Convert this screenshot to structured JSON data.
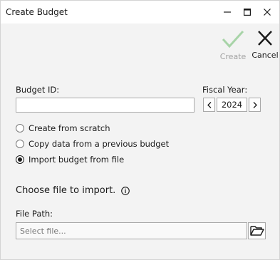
{
  "window": {
    "title": "Create Budget"
  },
  "toolbar": {
    "create_label": "Create",
    "cancel_label": "Cancel",
    "create_icon": "checkmark-icon",
    "cancel_icon": "close-x-icon"
  },
  "form": {
    "budget_id_label": "Budget ID:",
    "budget_id_value": "",
    "fiscal_year_label": "Fiscal Year:",
    "fiscal_year_value": "2024",
    "options": [
      {
        "label": "Create from scratch",
        "checked": false
      },
      {
        "label": "Copy data from a previous budget",
        "checked": false
      },
      {
        "label": "Import budget from file",
        "checked": true
      }
    ],
    "import_heading": "Choose file to import.",
    "file_path_label": "File Path:",
    "file_path_placeholder": "Select file...",
    "browse_icon": "folder-open-icon"
  },
  "colors": {
    "create_disabled": "#a8d4a8",
    "window_bg": "#f3f3f3",
    "titlebar_bg": "#ffffff"
  }
}
